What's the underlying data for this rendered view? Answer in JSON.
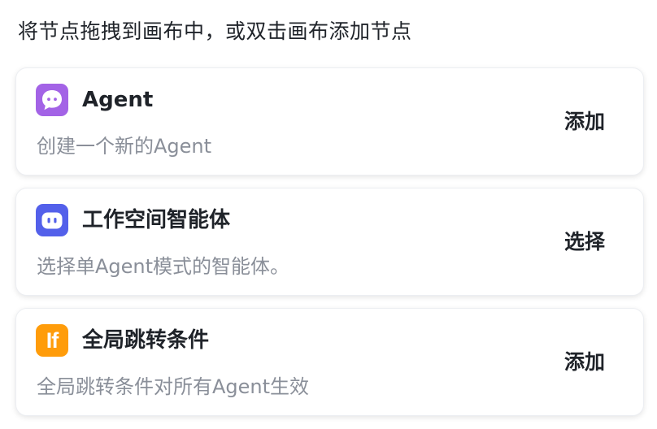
{
  "hint": "将节点拖拽到画布中，或双击画布添加节点",
  "cards": [
    {
      "title": "Agent",
      "description": "创建一个新的Agent",
      "action": "添加",
      "icon": "chat-bubble-icon",
      "icon_color": "#a363e6"
    },
    {
      "title": "工作空间智能体",
      "description": "选择单Agent模式的智能体。",
      "action": "选择",
      "icon": "bot-face-icon",
      "icon_color": "#5360ea"
    },
    {
      "title": "全局跳转条件",
      "description": "全局跳转条件对所有Agent生效",
      "action": "添加",
      "icon": "if-condition-icon",
      "icon_label": "If",
      "icon_color": "#ff9c0a"
    }
  ]
}
